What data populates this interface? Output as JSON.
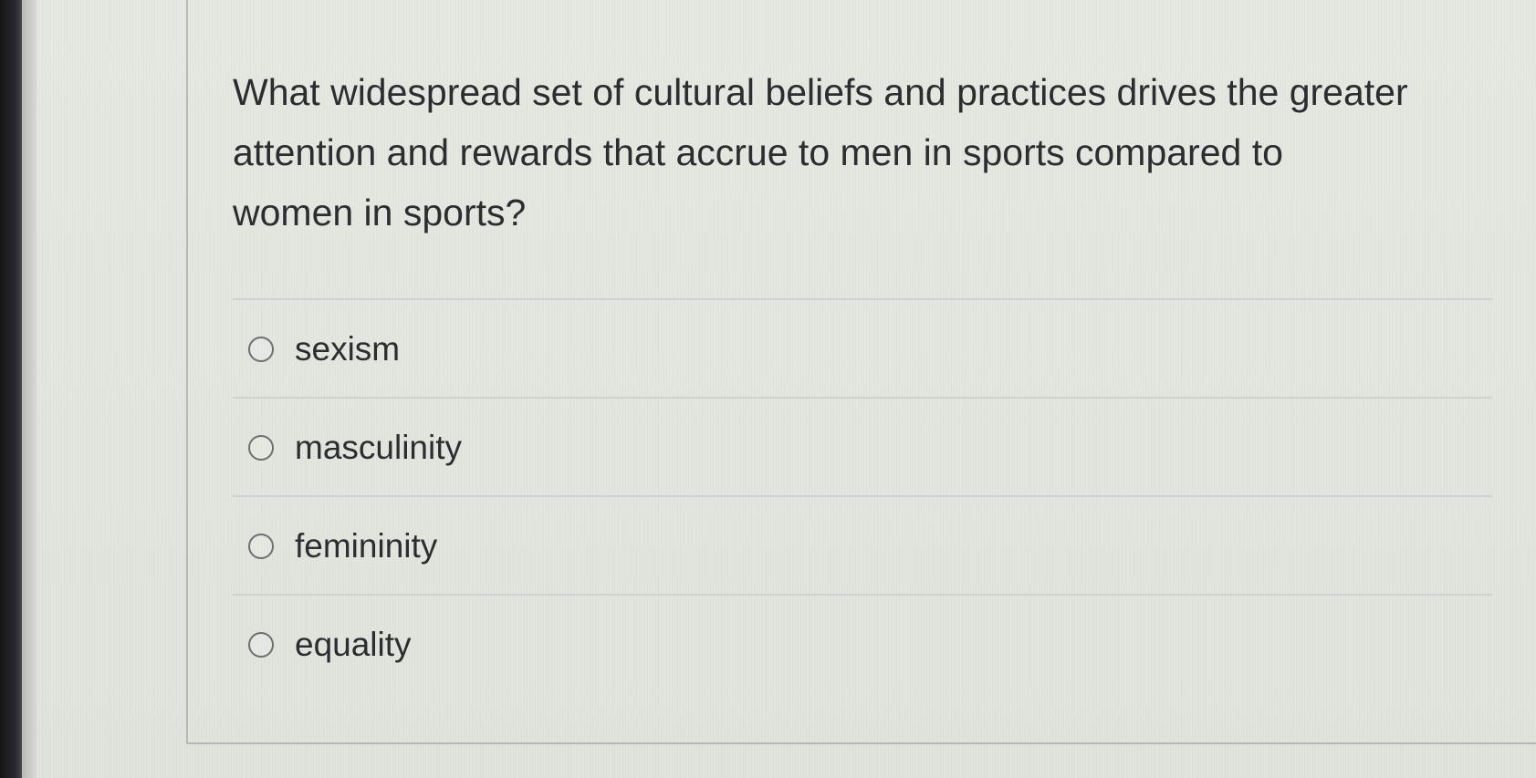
{
  "question": {
    "line1": "What widespread set of cultural beliefs and practices drives the greater",
    "line2": "attention and rewards that accrue to men in sports compared to",
    "line3": "women in sports?"
  },
  "options": [
    {
      "label": "sexism",
      "selected": false
    },
    {
      "label": "masculinity",
      "selected": false
    },
    {
      "label": "femininity",
      "selected": false
    },
    {
      "label": "equality",
      "selected": false
    }
  ],
  "colors": {
    "text": "#2c2d30",
    "radio_border": "#6d7072",
    "divider": "#cfd2cf",
    "background": "#e3e5df"
  }
}
